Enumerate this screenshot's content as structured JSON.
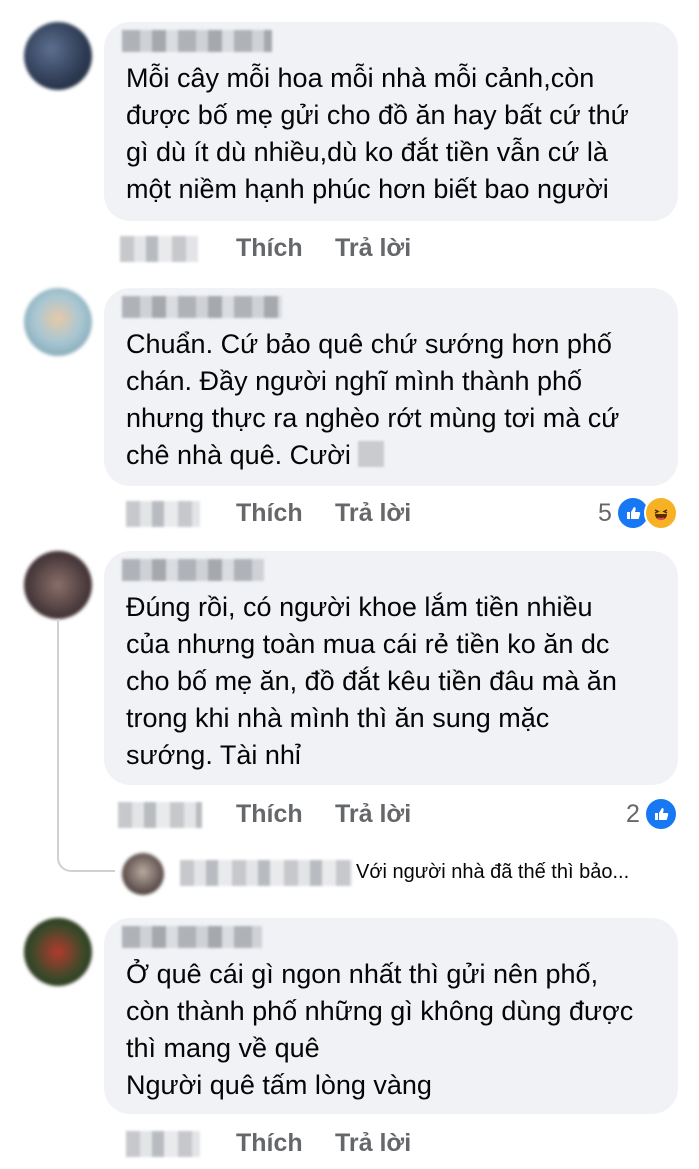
{
  "actions": {
    "like": "Thích",
    "reply": "Trả lời"
  },
  "comments": [
    {
      "text": "Mỗi cây mỗi hoa mỗi nhà mỗi cảnh,còn\nđược bố mẹ gửi cho đồ ăn hay bất cứ thứ\ngì dù ít dù nhiều,dù ko đắt tiền vẫn cứ là\nmột niềm hạnh phúc hơn biết bao người",
      "reactions": null
    },
    {
      "text": "Chuẩn. Cứ bảo quê chứ sướng hơn phố\nchán. Đầy người nghĩ mình thành phố\nnhưng thực ra nghèo rớt mùng tơi mà cứ\nchê nhà quê. Cười",
      "reactions": {
        "count": "5",
        "icons": [
          "like-icon",
          "haha-icon"
        ]
      }
    },
    {
      "text": "Đúng rồi, có người khoe lắm tiền nhiều\ncủa nhưng toàn mua cái rẻ tiền ko ăn dc\ncho bố mẹ ăn, đồ đắt kêu tiền đâu mà ăn\ntrong khi nhà mình thì ăn sung mặc\nsướng. Tài nhỉ",
      "reactions": {
        "count": "2",
        "icons": [
          "like-icon"
        ]
      },
      "reply_preview": "Với người nhà đã thế thì bảo..."
    },
    {
      "text": "Ở quê cái gì ngon nhất thì gửi nên phố,\ncòn thành phố những gì không dùng được\nthì mang về quê\nNgười quê tấm lòng vàng",
      "reactions": null
    }
  ],
  "colors": {
    "bubble": "#f0f2f5",
    "action_text": "#65676b",
    "like": "#1877f2",
    "haha": "#f7b125"
  }
}
